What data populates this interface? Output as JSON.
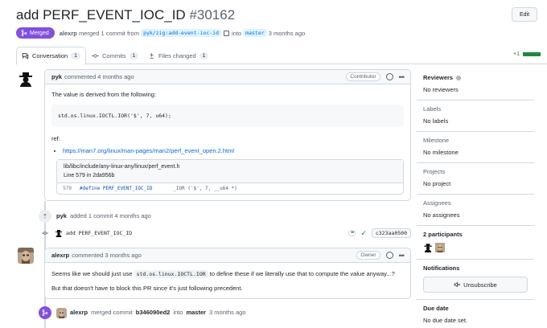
{
  "pr": {
    "title": "add PERF_EVENT_IOC_ID",
    "number": "#30162",
    "edit_label": "Edit",
    "state_label": "Merged",
    "author": "alexrp",
    "merge_text": "merged 1 commit from",
    "head_branch": "pyk/zig:add-event-ioc-id",
    "into_text": "into",
    "base_branch": "master",
    "when": "3 months ago"
  },
  "tabs": [
    {
      "label": "Conversation",
      "count": "1"
    },
    {
      "label": "Commits",
      "count": "1"
    },
    {
      "label": "Files changed",
      "count": "1"
    }
  ],
  "diffstat": "+1",
  "comment1": {
    "author": "pyk",
    "action": "commented 4 months ago",
    "role": "Contributor",
    "intro": "The value is derived from the following:",
    "code": "std.os.linux.IOCTL.IOR('$', 7, u64);",
    "ref_label": "ref:",
    "link": "https://man7.org/linux/man-pages/man2/perf_event_open.2.html",
    "embed_path": "lib/libc/include/any-linux-any/linux/perf_event.h",
    "embed_line_info": "Line 579 in 2da956b",
    "embed_ln": "579",
    "embed_code_kw": "#define PERF_EVENT_IOC_ID",
    "embed_code_rest": "_IOR ('$', 7, __u64 *)"
  },
  "event1": {
    "author": "pyk",
    "text": "added 1 commit 4 months ago"
  },
  "commit": {
    "message": "add PERF_EVENT_IOC_ID",
    "sha": "c323aa0500"
  },
  "comment2": {
    "author": "alexrp",
    "action": "commented 3 months ago",
    "role": "Owner",
    "p1_pre": "Seems like we should just use",
    "p1_code": "std.os.linux.IOCTL.IOR",
    "p1_post": "to define these if we literally use that to compute the value anyway...?",
    "p2": "But that doesn't have to block this PR since it's just following precedent."
  },
  "event2": {
    "author": "alexrp",
    "text_pre": "merged commit",
    "sha": "b346090ed2",
    "into": "into",
    "branch": "master",
    "when": "3 months ago"
  },
  "sidebar": {
    "reviewers_title": "Reviewers",
    "reviewers_value": "No reviewers",
    "labels_title": "Labels",
    "labels_value": "No labels",
    "milestone_title": "Milestone",
    "milestone_value": "No milestone",
    "projects_title": "Projects",
    "projects_value": "No project",
    "assignees_title": "Assignees",
    "assignees_value": "No assignees",
    "participants_title": "2 participants",
    "notifications_title": "Notifications",
    "unsubscribe_label": "Unsubscribe",
    "due_title": "Due date",
    "due_value": "No due date set."
  },
  "colors": {
    "merged": "#8250df",
    "link": "#0969da",
    "added": "#1a7f37"
  }
}
